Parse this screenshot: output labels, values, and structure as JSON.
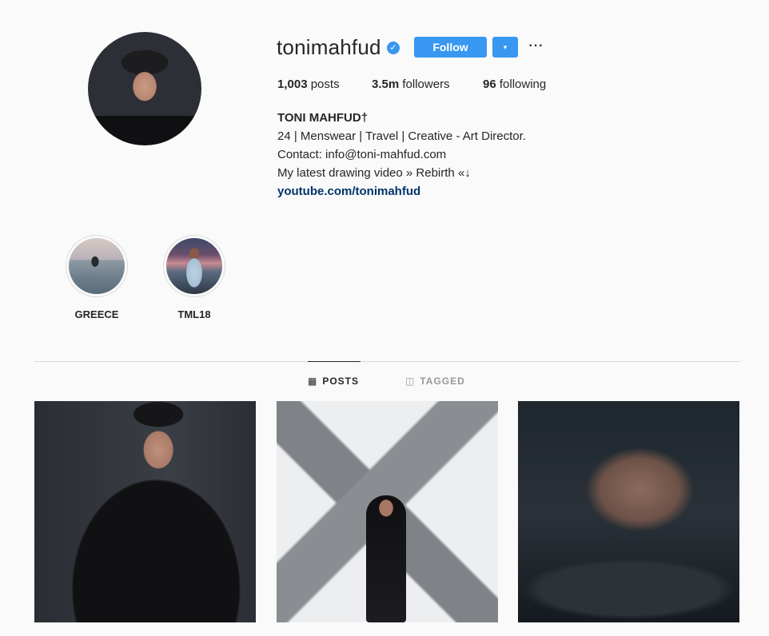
{
  "profile": {
    "username": "tonimahfud",
    "verified_icon": "verified-badge-icon",
    "follow_label": "Follow",
    "dropdown_icon": "▾",
    "more_icon": "···",
    "stats": {
      "posts_count": "1,003",
      "posts_label": "posts",
      "followers_count": "3.5m",
      "followers_label": "followers",
      "following_count": "96",
      "following_label": "following"
    },
    "bio": {
      "name": "TONI MAHFUD†",
      "line1": "24 | Menswear | Travel | Creative - Art Director.",
      "line2": "Contact: info@toni-mahfud.com",
      "line3": "My latest drawing video » Rebirth «↓",
      "link": "youtube.com/tonimahfud"
    }
  },
  "highlights": [
    {
      "label": "GREECE"
    },
    {
      "label": "TML18"
    }
  ],
  "tabs": {
    "posts_label": "POSTS",
    "tagged_label": "TAGGED",
    "posts_icon": "▦",
    "tagged_icon": "◫"
  },
  "colors": {
    "accent": "#3897f0",
    "link": "#003569",
    "background": "#fafafa"
  }
}
